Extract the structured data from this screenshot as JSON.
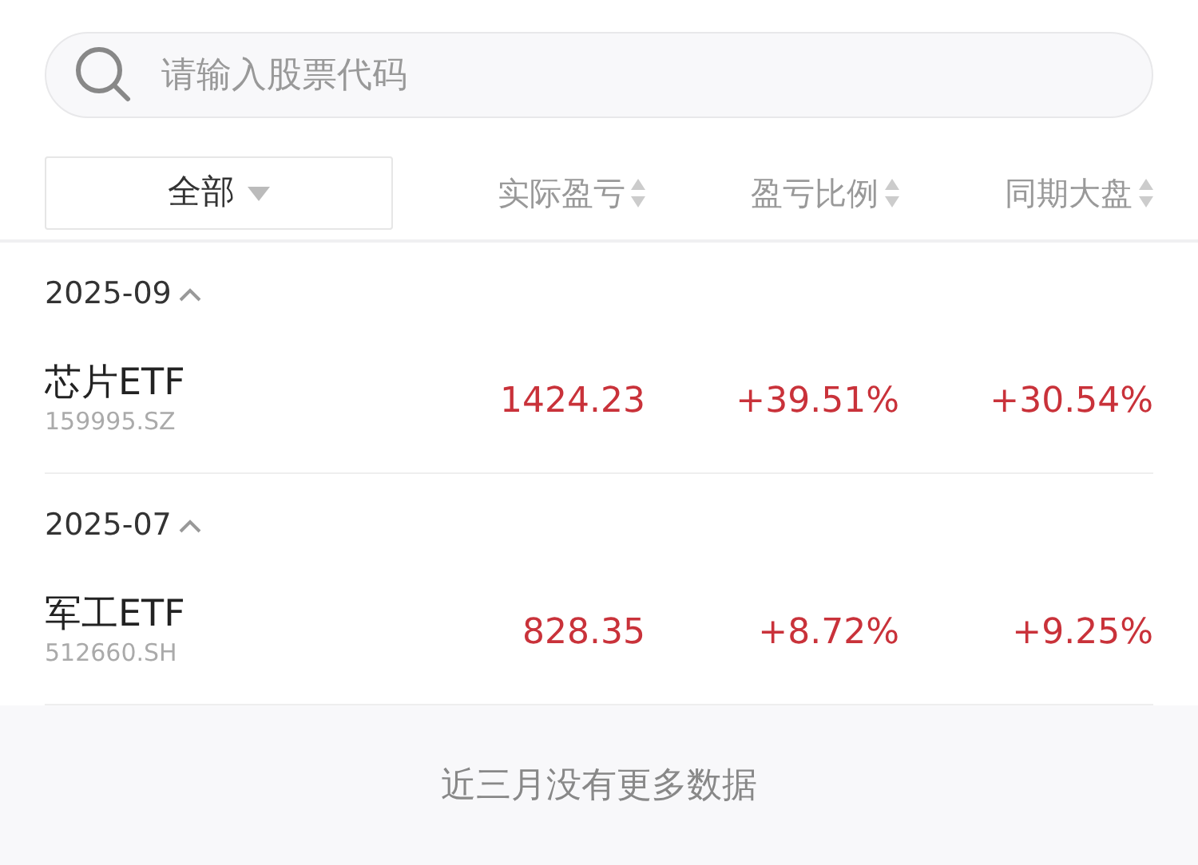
{
  "search": {
    "placeholder": "请输入股票代码"
  },
  "filter": {
    "label": "全部"
  },
  "columns": [
    {
      "label": "实际盈亏"
    },
    {
      "label": "盈亏比例"
    },
    {
      "label": "同期大盘"
    }
  ],
  "groups": [
    {
      "month": "2025-09",
      "expanded": true,
      "rows": [
        {
          "name": "芯片ETF",
          "code": "159995.SZ",
          "profit": "1424.23",
          "ratio": "+39.51%",
          "market": "+30.54%"
        }
      ]
    },
    {
      "month": "2025-07",
      "expanded": true,
      "rows": [
        {
          "name": "军工ETF",
          "code": "512660.SH",
          "profit": "828.35",
          "ratio": "+8.72%",
          "market": "+9.25%"
        }
      ]
    }
  ],
  "footer": "近三月没有更多数据"
}
